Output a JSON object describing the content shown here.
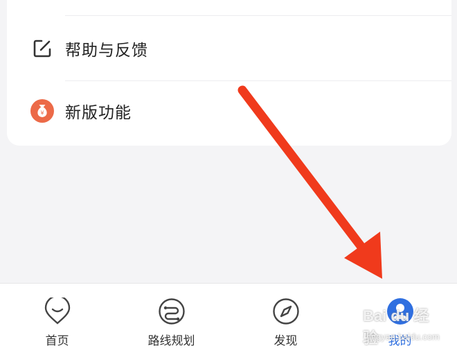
{
  "menu": {
    "items": [
      {
        "label": "帮助与反馈",
        "icon": "edit-icon"
      },
      {
        "label": "新版功能",
        "icon": "money-bag-icon"
      }
    ]
  },
  "tabbar": {
    "tabs": [
      {
        "label": "首页",
        "icon": "home-pin-icon",
        "active": false
      },
      {
        "label": "路线规划",
        "icon": "route-icon",
        "active": false
      },
      {
        "label": "发现",
        "icon": "compass-icon",
        "active": false
      },
      {
        "label": "我的",
        "icon": "user-avatar-icon",
        "active": true
      }
    ]
  },
  "watermark": {
    "top": "Bai du 经验",
    "bottom": "jingyan.baidu.com"
  },
  "colors": {
    "background": "#f4f4f6",
    "card": "#ffffff",
    "accent_blue": "#2f6fe0",
    "arrow_red": "#f03a1c",
    "money_bag_orange": "#ec6a48"
  }
}
